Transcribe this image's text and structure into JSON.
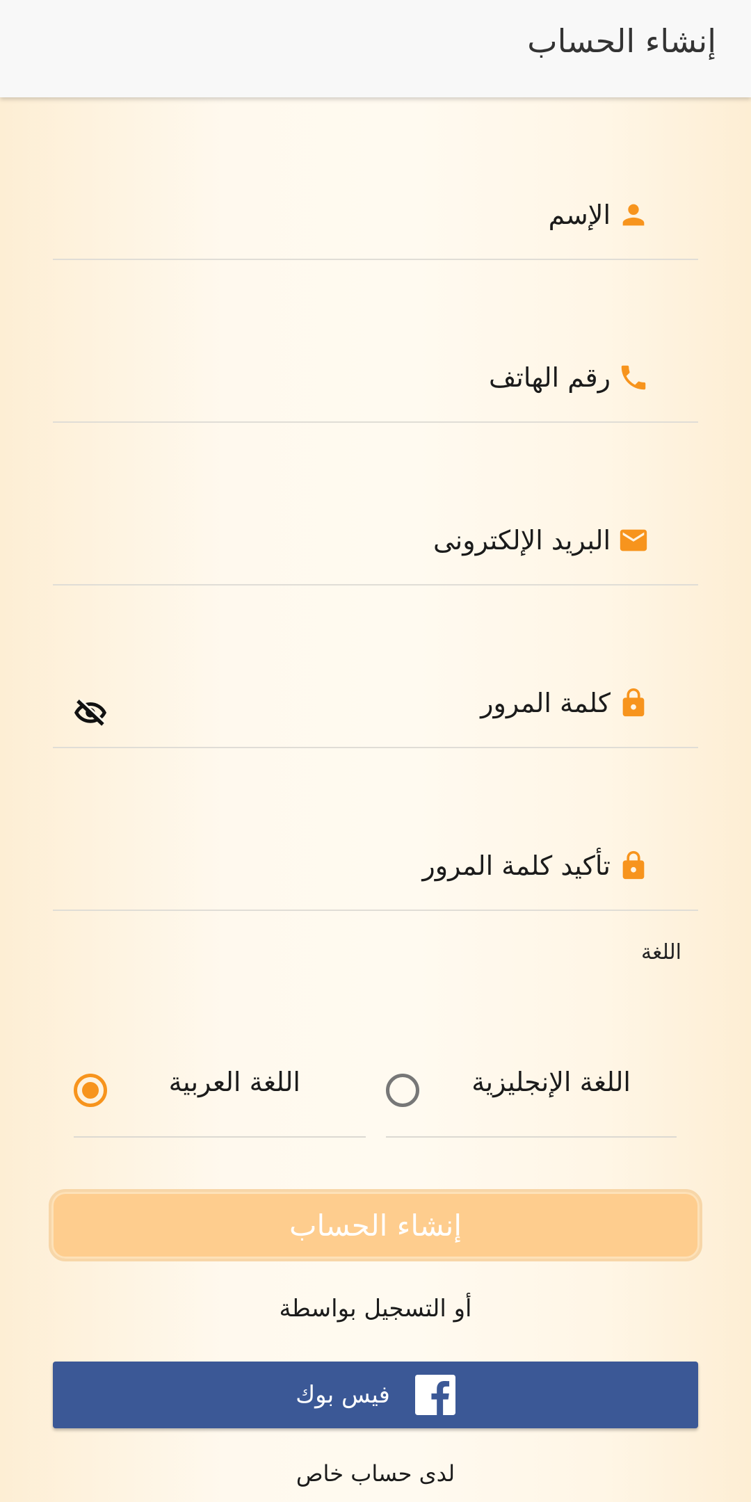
{
  "appbar": {
    "title": "إنشاء الحساب"
  },
  "fields": [
    {
      "label": "الإسم",
      "icon": "person-icon"
    },
    {
      "label": "رقم الهاتف",
      "icon": "phone-icon"
    },
    {
      "label": "البريد الإلكترونى",
      "icon": "mail-icon"
    },
    {
      "label": "كلمة المرور",
      "icon": "lock-icon",
      "toggle_icon": "eye-off-icon"
    },
    {
      "label": "تأكيد كلمة المرور",
      "icon": "lock-icon"
    }
  ],
  "language": {
    "label": "اللغة",
    "options": [
      {
        "label": "اللغة الإنجليزية",
        "selected": false
      },
      {
        "label": "اللغة العربية",
        "selected": true
      }
    ]
  },
  "actions": {
    "create_button": "إنشاء الحساب",
    "or_register": "أو التسجيل بواسطة",
    "facebook_button": "فيس بوك",
    "have_account": "لدى حساب خاص"
  },
  "colors": {
    "accent": "#f7941d",
    "button_disabled": "#fecd8e",
    "facebook": "#3b5896"
  }
}
